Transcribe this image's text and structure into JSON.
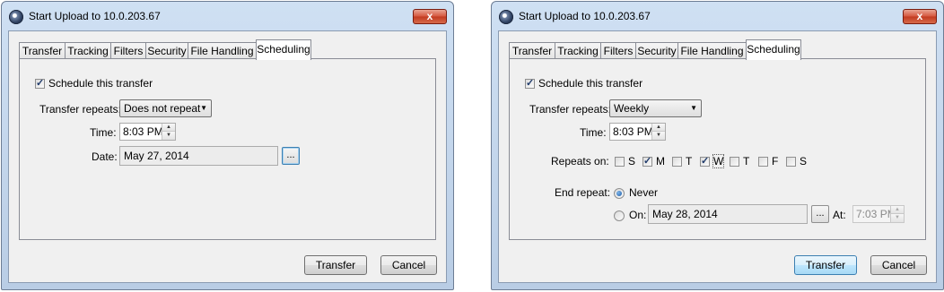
{
  "left": {
    "title": "Start Upload to 10.0.203.67",
    "close_label": "x",
    "tabs": [
      {
        "label": "Transfer"
      },
      {
        "label": "Tracking"
      },
      {
        "label": "Filters"
      },
      {
        "label": "Security"
      },
      {
        "label": "File Handling"
      },
      {
        "label": "Scheduling"
      }
    ],
    "active_tab": "Scheduling",
    "schedule_label": "Schedule this transfer",
    "schedule_checked": true,
    "repeats_label": "Transfer repeats:",
    "repeats_value": "Does not repeat",
    "time_label": "Time:",
    "time_value": "8:03 PM",
    "date_label": "Date:",
    "date_value": "May 27, 2014",
    "browse_label": "...",
    "transfer_label": "Transfer",
    "cancel_label": "Cancel"
  },
  "right": {
    "title": "Start Upload to 10.0.203.67",
    "close_label": "x",
    "tabs": [
      {
        "label": "Transfer"
      },
      {
        "label": "Tracking"
      },
      {
        "label": "Filters"
      },
      {
        "label": "Security"
      },
      {
        "label": "File Handling"
      },
      {
        "label": "Scheduling"
      }
    ],
    "active_tab": "Scheduling",
    "schedule_label": "Schedule this transfer",
    "schedule_checked": true,
    "repeats_label": "Transfer repeats:",
    "repeats_value": "Weekly",
    "time_label": "Time:",
    "time_value": "8:03 PM",
    "repeats_on_label": "Repeats on:",
    "days": [
      {
        "label": "S",
        "checked": false
      },
      {
        "label": "M",
        "checked": true
      },
      {
        "label": "T",
        "checked": false
      },
      {
        "label": "W",
        "checked": true
      },
      {
        "label": "T",
        "checked": false
      },
      {
        "label": "F",
        "checked": false
      },
      {
        "label": "S",
        "checked": false
      }
    ],
    "end_repeat_label": "End repeat:",
    "never_label": "Never",
    "never_selected": true,
    "on_label": "On:",
    "on_date_value": "May 28, 2014",
    "browse_label": "...",
    "at_label": "At:",
    "at_time_value": "7:03 PM",
    "transfer_label": "Transfer",
    "cancel_label": "Cancel"
  },
  "colors": {
    "title_bar": "#c4d7ed",
    "close_button": "#c9452a",
    "default_button_border": "#3c7fb1"
  },
  "icons": [
    "app-globe-icon",
    "close-icon",
    "check-icon",
    "spin-up-icon",
    "spin-down-icon",
    "dropdown-arrow-icon",
    "radio-dot-icon"
  ]
}
